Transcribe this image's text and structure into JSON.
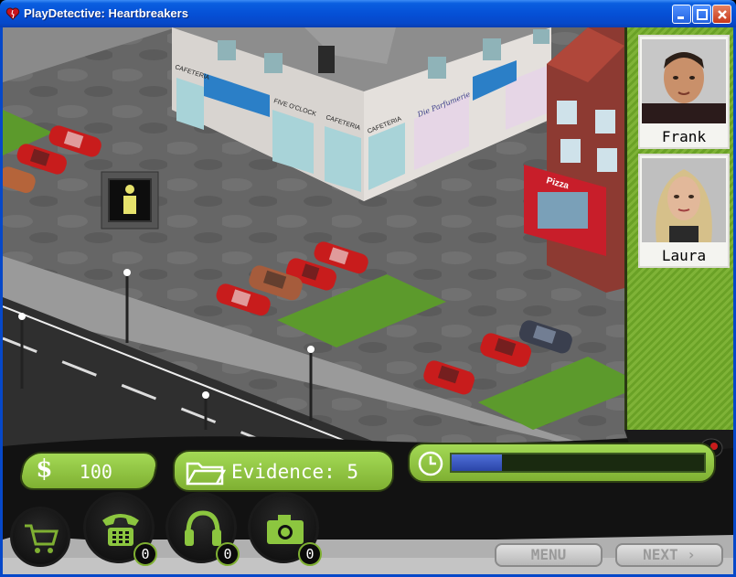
{
  "window": {
    "title": "PlayDetective: Heartbreakers"
  },
  "scene": {
    "shop_signs": [
      "CAFETERIA",
      "FIVE O'CLOCK",
      "CAFETERIA",
      "CAFETERIA"
    ],
    "perfume_sign": "Die Parfumerie",
    "pizza_sign": "Pizza",
    "asphalt_color": "#5e5e5e",
    "grass_color": "#5c9a2c",
    "car_color": "#c81c1c"
  },
  "suspects": [
    {
      "name": "Frank"
    },
    {
      "name": "Laura"
    }
  ],
  "hud": {
    "money_symbol": "$",
    "money": "100",
    "evidence_label": "Evidence: 5",
    "timer_progress": 0.2,
    "tools": [
      {
        "id": "cart",
        "icon": "shopping-cart-icon",
        "count": null
      },
      {
        "id": "phone",
        "icon": "telephone-icon",
        "count": "0"
      },
      {
        "id": "headset",
        "icon": "headphones-icon",
        "count": "0"
      },
      {
        "id": "camera",
        "icon": "camera-icon",
        "count": "0"
      }
    ],
    "menu_label": "MENU",
    "next_label": "NEXT ›"
  },
  "colors": {
    "accent_green": "#8cc63f",
    "titlebar_blue": "#0550d6",
    "progress_blue": "#3b55c0"
  }
}
